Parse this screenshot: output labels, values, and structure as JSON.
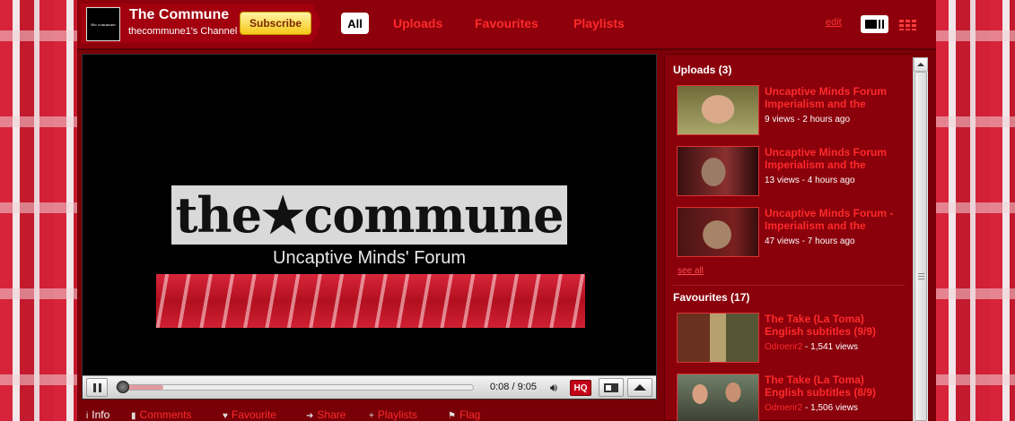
{
  "channel": {
    "title": "The Commune",
    "subtitle": "thecommune1's Channel",
    "avatar_text": "the commune",
    "subscribe_label": "Subscribe"
  },
  "tabs": [
    "All",
    "Uploads",
    "Favourites",
    "Playlists"
  ],
  "active_tab": "All",
  "edit_label": "edit",
  "player": {
    "logo_text": "the★commune",
    "forum_text": "Uncaptive Minds' Forum",
    "time_display": "0:08 / 9:05",
    "hq_label": "HQ",
    "progress_fraction": 0.0147
  },
  "info_tabs": [
    {
      "icon": "i",
      "label": "Info"
    },
    {
      "icon": "▮",
      "label": "Comments"
    },
    {
      "icon": "♥",
      "label": "Favourite"
    },
    {
      "icon": "➜",
      "label": "Share"
    },
    {
      "icon": "+",
      "label": "Playlists"
    },
    {
      "icon": "⚑",
      "label": "Flag"
    }
  ],
  "sidebar": {
    "uploads_title": "Uploads (3)",
    "uploads": [
      {
        "title": "Uncaptive Minds Forum Imperialism and the",
        "meta": "9 views - 2 hours ago"
      },
      {
        "title": "Uncaptive Minds Forum Imperialism and the",
        "meta": "13 views - 4 hours ago"
      },
      {
        "title": "Uncaptive Minds Forum - Imperialism and the",
        "meta": "47 views - 7 hours ago"
      }
    ],
    "see_all": "see all",
    "favourites_title": "Favourites (17)",
    "favourites": [
      {
        "title": "The Take (La Toma) English subtitles (9/9)",
        "author": "Odroerir2",
        "views": " - 1,541 views"
      },
      {
        "title": "The Take (La Toma) English subtitles (8/9)",
        "author": "Odroerir2",
        "views": " - 1,506 views"
      }
    ]
  },
  "colors": {
    "accent": "#ff2a2a",
    "header_bg": "#8e000b",
    "subscribe": "#f7c817"
  }
}
